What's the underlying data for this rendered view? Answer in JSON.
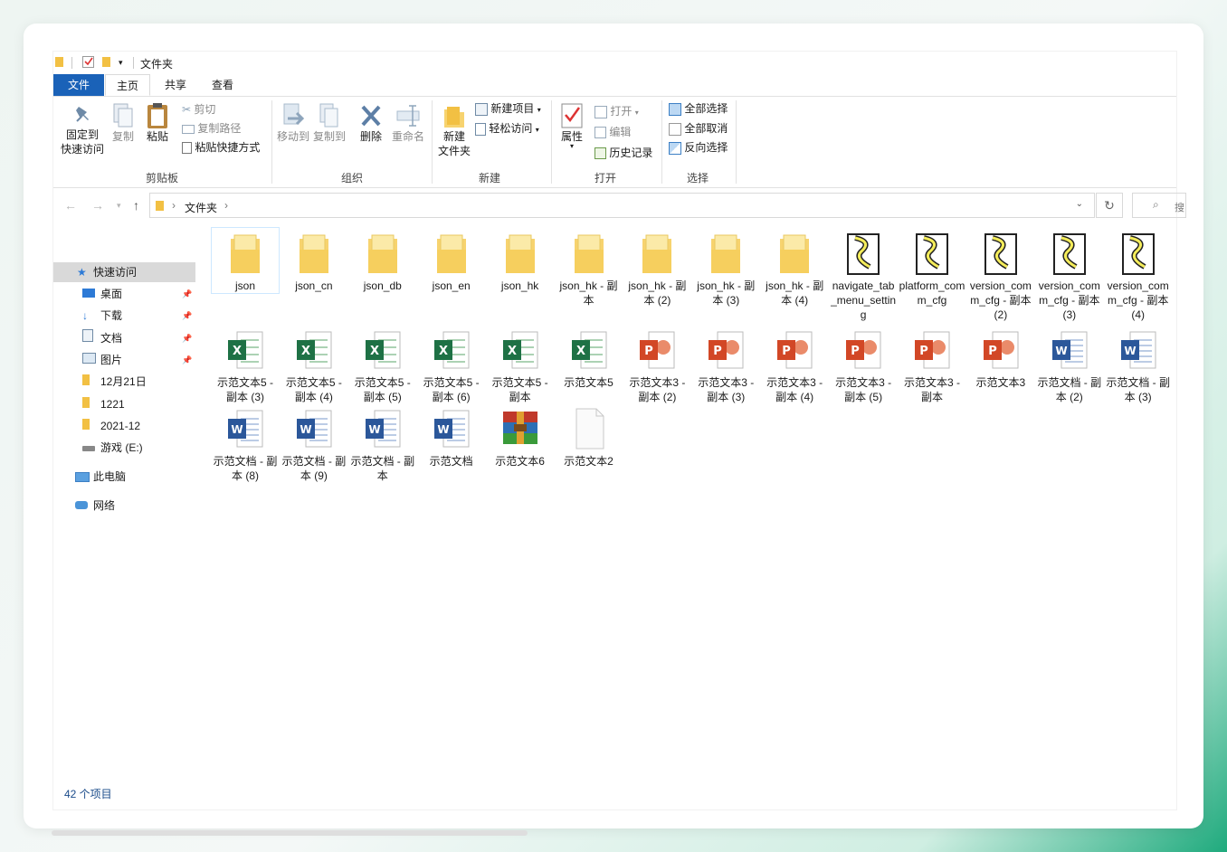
{
  "window": {
    "title": "文件夹"
  },
  "tabs": [
    {
      "label": "文件"
    },
    {
      "label": "主页"
    },
    {
      "label": "共享"
    },
    {
      "label": "查看"
    }
  ],
  "ribbon": {
    "clipboard": {
      "pin": "固定到\n快速访问",
      "copy": "复制",
      "paste": "粘贴",
      "cut": "剪切",
      "copy_path": "复制路径",
      "paste_shortcut": "粘贴快捷方式",
      "label": "剪贴板"
    },
    "organize": {
      "move_to": "移动到",
      "copy_to": "复制到",
      "delete": "删除",
      "rename": "重命名",
      "label": "组织"
    },
    "new": {
      "new_folder": "新建\n文件夹",
      "new_item": "新建项目",
      "easy_access": "轻松访问",
      "label": "新建"
    },
    "open": {
      "properties": "属性",
      "open": "打开",
      "edit": "编辑",
      "history": "历史记录",
      "label": "打开"
    },
    "select": {
      "select_all": "全部选择",
      "select_none": "全部取消",
      "invert": "反向选择",
      "label": "选择"
    }
  },
  "address": {
    "crumb": "文件夹",
    "search_hint": "搜"
  },
  "nav": {
    "quick_access": "快速访问",
    "items": [
      {
        "label": "桌面",
        "icon": "desktop-icon"
      },
      {
        "label": "下载",
        "icon": "download-icon"
      },
      {
        "label": "文档",
        "icon": "document-icon"
      },
      {
        "label": "图片",
        "icon": "picture-icon"
      },
      {
        "label": "12月21日",
        "icon": "folder-icon"
      },
      {
        "label": "1221",
        "icon": "folder-icon"
      },
      {
        "label": "2021-12",
        "icon": "folder-icon"
      },
      {
        "label": "游戏 (E:)",
        "icon": "drive-icon"
      }
    ],
    "this_pc": "此电脑",
    "network": "网络"
  },
  "files": [
    {
      "name": "json",
      "type": "folder"
    },
    {
      "name": "json_cn",
      "type": "folder"
    },
    {
      "name": "json_db",
      "type": "folder"
    },
    {
      "name": "json_en",
      "type": "folder"
    },
    {
      "name": "json_hk",
      "type": "folder"
    },
    {
      "name": "json_hk - 副本",
      "type": "folder"
    },
    {
      "name": "json_hk - 副本 (2)",
      "type": "folder"
    },
    {
      "name": "json_hk - 副本 (3)",
      "type": "folder"
    },
    {
      "name": "json_hk - 副本 (4)",
      "type": "folder"
    },
    {
      "name": "navigate_tab_menu_setting",
      "type": "script"
    },
    {
      "name": "platform_comm_cfg",
      "type": "script"
    },
    {
      "name": "version_comm_cfg - 副本 (2)",
      "type": "script"
    },
    {
      "name": "version_comm_cfg - 副本 (3)",
      "type": "script"
    },
    {
      "name": "version_comm_cfg - 副本 (4)",
      "type": "script"
    },
    {
      "name": "示范文本5 - 副本 (3)",
      "type": "excel"
    },
    {
      "name": "示范文本5 - 副本 (4)",
      "type": "excel"
    },
    {
      "name": "示范文本5 - 副本 (5)",
      "type": "excel"
    },
    {
      "name": "示范文本5 - 副本 (6)",
      "type": "excel"
    },
    {
      "name": "示范文本5 - 副本",
      "type": "excel"
    },
    {
      "name": "示范文本5",
      "type": "excel"
    },
    {
      "name": "示范文本3 - 副本 (2)",
      "type": "ppt"
    },
    {
      "name": "示范文本3 - 副本 (3)",
      "type": "ppt"
    },
    {
      "name": "示范文本3 - 副本 (4)",
      "type": "ppt"
    },
    {
      "name": "示范文本3 - 副本 (5)",
      "type": "ppt"
    },
    {
      "name": "示范文本3 - 副本",
      "type": "ppt"
    },
    {
      "name": "示范文本3",
      "type": "ppt"
    },
    {
      "name": "示范文档 - 副本 (2)",
      "type": "word"
    },
    {
      "name": "示范文档 - 副本 (3)",
      "type": "word"
    },
    {
      "name": "示范文档 - 副本 (8)",
      "type": "word"
    },
    {
      "name": "示范文档 - 副本 (9)",
      "type": "word"
    },
    {
      "name": "示范文档 - 副本",
      "type": "word"
    },
    {
      "name": "示范文档",
      "type": "word"
    },
    {
      "name": "示范文本6",
      "type": "rar"
    },
    {
      "name": "示范文本2",
      "type": "blank"
    }
  ],
  "status": {
    "count": "42 个项目"
  },
  "colors": {
    "file_tab": "#1a62b8",
    "selected_nav": "#d9d9d9",
    "excel": "#1e7145",
    "word": "#2b579a",
    "ppt": "#d24726",
    "folder": "#f7d36f"
  }
}
